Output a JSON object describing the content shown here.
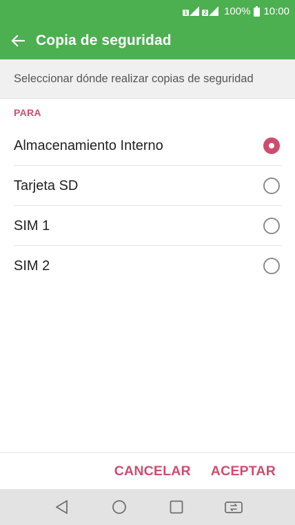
{
  "status_bar": {
    "sim1_tag": "1",
    "sim2_tag": "2",
    "battery": "100%",
    "time": "10:00"
  },
  "app_bar": {
    "title": "Copia de seguridad",
    "back_icon": "arrow-left-icon"
  },
  "subheader": {
    "text": "Seleccionar dónde realizar copias de seguridad"
  },
  "section": {
    "label": "PARA"
  },
  "options": [
    {
      "label": "Almacenamiento Interno",
      "selected": true
    },
    {
      "label": "Tarjeta SD",
      "selected": false
    },
    {
      "label": "SIM 1",
      "selected": false
    },
    {
      "label": "SIM 2",
      "selected": false
    }
  ],
  "buttons": {
    "cancel": "CANCELAR",
    "accept": "ACEPTAR"
  },
  "nav_bar": {
    "icons": [
      "back-triangle-icon",
      "home-circle-icon",
      "recents-square-icon",
      "dual-window-icon"
    ]
  },
  "colors": {
    "primary": "#4caf50",
    "accent": "#cf4c6e"
  }
}
